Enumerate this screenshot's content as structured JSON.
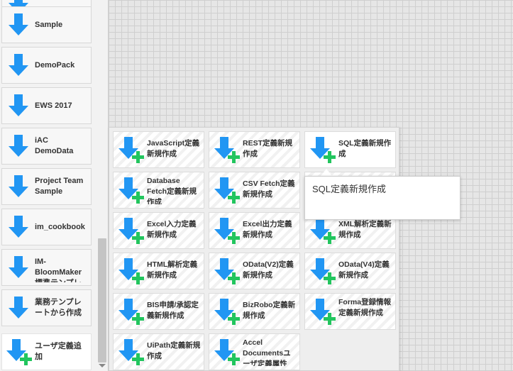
{
  "colors": {
    "arrow": "#2196f3",
    "plus": "#22c55e"
  },
  "sidebar": {
    "items": [
      {
        "label": "",
        "icon": "download-arrow-icon"
      },
      {
        "label": "Sample",
        "icon": "download-arrow-icon"
      },
      {
        "label": "DemoPack",
        "icon": "download-arrow-icon"
      },
      {
        "label": "EWS 2017",
        "icon": "download-arrow-icon"
      },
      {
        "label": "iAC DemoData",
        "icon": "download-arrow-icon"
      },
      {
        "label": "Project Team Sample",
        "icon": "download-arrow-icon"
      },
      {
        "label": "im_cookbook",
        "icon": "download-arrow-icon"
      },
      {
        "label": "IM-BloomMaker 標準テンプレ",
        "icon": "download-arrow-icon"
      },
      {
        "label": "業務テンプレートから作成",
        "icon": "download-arrow-icon"
      },
      {
        "label": "ユーザ定義追加",
        "icon": "download-arrow-plus-icon"
      }
    ]
  },
  "popup": {
    "tiles": [
      {
        "label": "JavaScript定義新規作成"
      },
      {
        "label": "REST定義新規作成"
      },
      {
        "label": "SQL定義新規作成"
      },
      {
        "label": "Database Fetch定義新規作成"
      },
      {
        "label": "CSV Fetch定義新規作成"
      },
      {
        "label": ""
      },
      {
        "label": "Excel入力定義新規作成"
      },
      {
        "label": "Excel出力定義新規作成"
      },
      {
        "label": "XML解析定義新規作成"
      },
      {
        "label": "HTML解析定義新規作成"
      },
      {
        "label": "OData(V2)定義新規作成"
      },
      {
        "label": "OData(V4)定義新規作成"
      },
      {
        "label": "BIS申請/承認定義新規作成"
      },
      {
        "label": "BizRobo定義新規作成"
      },
      {
        "label": "Forma登録情報定義新規作成"
      },
      {
        "label": "UiPath定義新規作成"
      },
      {
        "label": "Accel Documentsユーザ定義属性"
      }
    ]
  },
  "tooltip": {
    "text": "SQL定義新規作成"
  }
}
